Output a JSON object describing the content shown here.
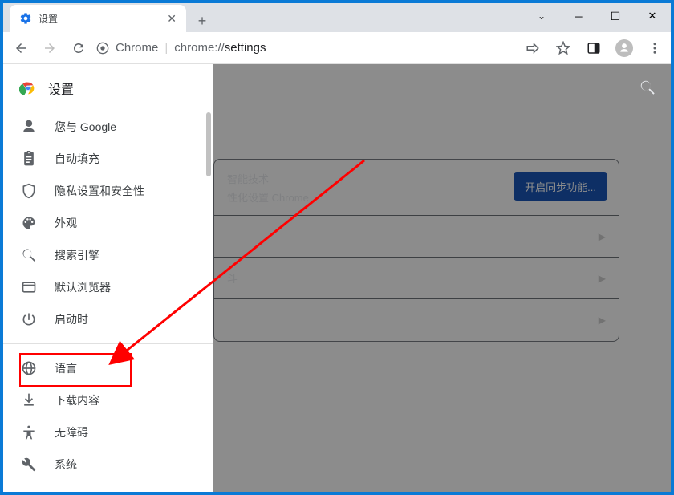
{
  "tab": {
    "title": "设置"
  },
  "url": {
    "prefix": "Chrome",
    "sep": "|",
    "path_light": "chrome://",
    "path_dark": "settings"
  },
  "sidebar": {
    "title": "设置",
    "items": [
      {
        "label": "您与 Google"
      },
      {
        "label": "自动填充"
      },
      {
        "label": "隐私设置和安全性"
      },
      {
        "label": "外观"
      },
      {
        "label": "搜索引擎"
      },
      {
        "label": "默认浏览器"
      },
      {
        "label": "启动时"
      }
    ],
    "items2": [
      {
        "label": "语言"
      },
      {
        "label": "下载内容"
      },
      {
        "label": "无障碍"
      },
      {
        "label": "系统"
      }
    ]
  },
  "main": {
    "row1_line1": "智能技术",
    "row1_line2": "性化设置 Chrome",
    "row3_fragment": "斗",
    "sync_btn": "开启同步功能..."
  }
}
